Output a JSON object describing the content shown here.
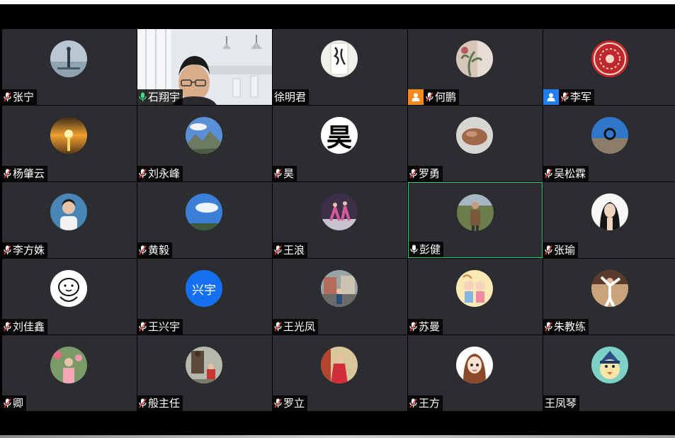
{
  "window": {
    "background": "#000000"
  },
  "colors": {
    "tile_bg": "#2b2d31",
    "active_border": "#2ecc71",
    "muted_mic": "#ffffff",
    "mute_slash": "#e53935",
    "unmuted_mic": "#3ddc84",
    "role_orange": "#f5891f",
    "role_blue": "#1e7ef2"
  },
  "participants": [
    {
      "name": "张宁",
      "mic": "muted",
      "avatar": "person-on-pier"
    },
    {
      "name": "石翔宇",
      "mic": "on",
      "avatar": "live-video"
    },
    {
      "name": "徐明君",
      "mic": "none",
      "avatar": "calligraphy-scroll"
    },
    {
      "name": "何鹏",
      "mic": "muted",
      "role": "host-orange-icon",
      "avatar": "plant-on-wall"
    },
    {
      "name": "李军",
      "mic": "muted",
      "role": "cohost-blue-icon",
      "avatar": "red-ornament"
    },
    {
      "name": "杨肇云",
      "mic": "muted",
      "avatar": "sunset-sea"
    },
    {
      "name": "刘永峰",
      "mic": "muted",
      "avatar": "mountain-sky"
    },
    {
      "name": "昊",
      "mic": "muted",
      "avatar": "character-hao",
      "avatar_text": "昊"
    },
    {
      "name": "罗勇",
      "mic": "muted",
      "avatar": "stone"
    },
    {
      "name": "吴松霖",
      "mic": "muted",
      "avatar": "sea-horizon"
    },
    {
      "name": "李方姝",
      "mic": "muted",
      "avatar": "woman-portrait"
    },
    {
      "name": "黄毅",
      "mic": "muted",
      "avatar": "blue-sky"
    },
    {
      "name": "王浪",
      "mic": "muted",
      "avatar": "dancers"
    },
    {
      "name": "彭健",
      "mic": "on-white",
      "avatar": "man-outdoors",
      "active": true
    },
    {
      "name": "张瑜",
      "mic": "muted",
      "avatar": "woman-white-bg"
    },
    {
      "name": "刘佳鑫",
      "mic": "muted",
      "avatar": "cartoon-doodle"
    },
    {
      "name": "王兴宇",
      "mic": "muted",
      "avatar": "initials-blue",
      "avatar_text": "兴宇"
    },
    {
      "name": "王光凤",
      "mic": "muted",
      "avatar": "street-scene"
    },
    {
      "name": "苏曼",
      "mic": "muted",
      "avatar": "cartoon-couple"
    },
    {
      "name": "朱教练",
      "mic": "muted",
      "avatar": "athlete-pose"
    },
    {
      "name": "卿",
      "mic": "muted",
      "avatar": "woman-flowers"
    },
    {
      "name": "般主任",
      "mic": "muted",
      "avatar": "statue-group"
    },
    {
      "name": "罗立",
      "mic": "muted",
      "avatar": "woman-red-dress"
    },
    {
      "name": "王方",
      "mic": "muted",
      "avatar": "anime-girl"
    },
    {
      "name": "王凤琴",
      "mic": "none",
      "avatar": "cartoon-bird"
    }
  ]
}
